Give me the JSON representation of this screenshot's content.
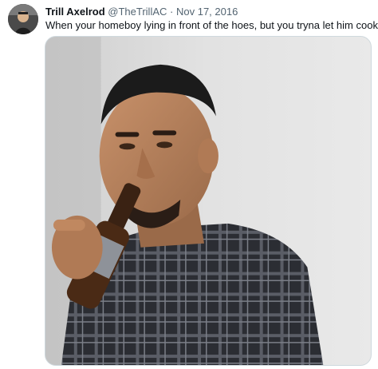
{
  "tweet": {
    "author_name": "Trill Axelrod",
    "author_handle": "@TheTrillAC",
    "separator": "·",
    "date": "Nov 17, 2016",
    "text": "When your homeboy lying in front of the hoes, but you tryna let him cook"
  },
  "icons": {
    "avatar": "profile-avatar-icon"
  },
  "colors": {
    "text_primary": "#0f1419",
    "text_secondary": "#536471",
    "media_border": "#cfd9de"
  }
}
